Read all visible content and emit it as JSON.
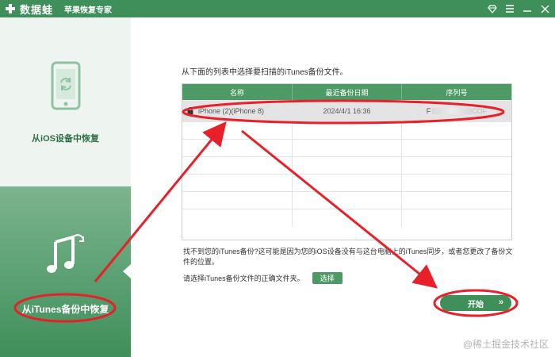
{
  "titlebar": {
    "app_name": "数据蛙",
    "subtitle": "苹果恢复专家",
    "icons": [
      "diamond-icon",
      "menu-icon",
      "minimize-icon",
      "close-icon"
    ]
  },
  "sidebar": {
    "items": [
      {
        "label": "从iOS设备中恢复",
        "icon": "phone-sync-icon",
        "active": false
      },
      {
        "label": "从iTunes备份中恢复",
        "icon": "music-note-icon",
        "active": true
      }
    ]
  },
  "main": {
    "instruction": "从下面的列表中选择要扫描的iTunes备份文件。",
    "table": {
      "columns": [
        "名称",
        "最近备份日期",
        "序列号"
      ],
      "rows": [
        {
          "name": "iPhone (2)(iPhone 8)",
          "date": "2024/4/1 16:36",
          "serial_prefix": "F",
          "serial_suffix": "COF",
          "selected": true,
          "locked": true
        }
      ]
    },
    "help_text": "找不到您的iTunes备份?这可能是因为您的iOS设备没有与这台电脑上的iTunes同步，或者您更改了备份文件的位置。",
    "choose_text": "请选择iTunes备份文件的正确文件夹。",
    "choose_button": "选择",
    "start_button": "开始",
    "start_arrow": "»"
  },
  "watermark": "@稀土掘金技术社区",
  "colors": {
    "primary": "#3f8f5a",
    "header": "#4e9a66",
    "annotation": "#e8202a"
  }
}
